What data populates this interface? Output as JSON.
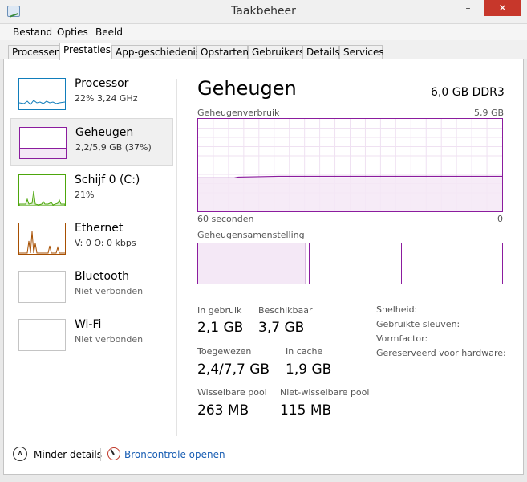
{
  "window": {
    "title": "Taakbeheer",
    "min_glyph": "–",
    "max_glyph": "□",
    "close_glyph": "✕"
  },
  "menu": [
    "Bestand",
    "Opties",
    "Beeld"
  ],
  "tabs": [
    {
      "label": "Processen",
      "active": false
    },
    {
      "label": "Prestaties",
      "active": true
    },
    {
      "label": "App-geschiedenis",
      "active": false
    },
    {
      "label": "Opstarten",
      "active": false
    },
    {
      "label": "Gebruikers",
      "active": false
    },
    {
      "label": "Details",
      "active": false
    },
    {
      "label": "Services",
      "active": false
    }
  ],
  "sidebar": {
    "items": [
      {
        "name": "Processor",
        "sub": "22% 3,24 GHz",
        "color": "#117dbb"
      },
      {
        "name": "Geheugen",
        "sub": "2,2/5,9 GB (37%)",
        "color": "#8b1c9e",
        "selected": true
      },
      {
        "name": "Schijf 0 (C:)",
        "sub": "21%",
        "color": "#4da60c"
      },
      {
        "name": "Ethernet",
        "sub": "V: 0 O: 0 kbps",
        "color": "#a74f01"
      },
      {
        "name": "Bluetooth",
        "sub": "Niet verbonden",
        "color": "#c4c4c4"
      },
      {
        "name": "Wi-Fi",
        "sub": "Niet verbonden",
        "color": "#c4c4c4"
      }
    ]
  },
  "main": {
    "title": "Geheugen",
    "spec": "6,0 GB DDR3",
    "graph": {
      "label": "Geheugenverbruik",
      "max_label": "5,9 GB",
      "time_label": "60 seconden",
      "zero_label": "0",
      "usage_fraction": 0.37
    },
    "composition_label": "Geheugensamenstelling",
    "stats": [
      {
        "label": "In gebruik",
        "value": "2,1 GB"
      },
      {
        "label": "Beschikbaar",
        "value": "3,7 GB"
      },
      {
        "label": "Toegewezen",
        "value": "2,4/7,7 GB"
      },
      {
        "label": "In cache",
        "value": "1,9 GB"
      },
      {
        "label": "Wisselbare pool",
        "value": "263 MB"
      },
      {
        "label": "Niet-wisselbare pool",
        "value": "115 MB"
      }
    ],
    "right_info": [
      "Snelheid:",
      "Gebruikte sleuven:",
      "Vormfactor:",
      "Gereserveerd voor hardware:"
    ]
  },
  "footer": {
    "less_details": "Minder details",
    "resource_monitor": "Broncontrole openen",
    "collapse_glyph": "∧"
  },
  "colors": {
    "memory_accent": "#8b1c9e",
    "memory_fill": "#f4e8f6",
    "link": "#1a5fb4"
  }
}
